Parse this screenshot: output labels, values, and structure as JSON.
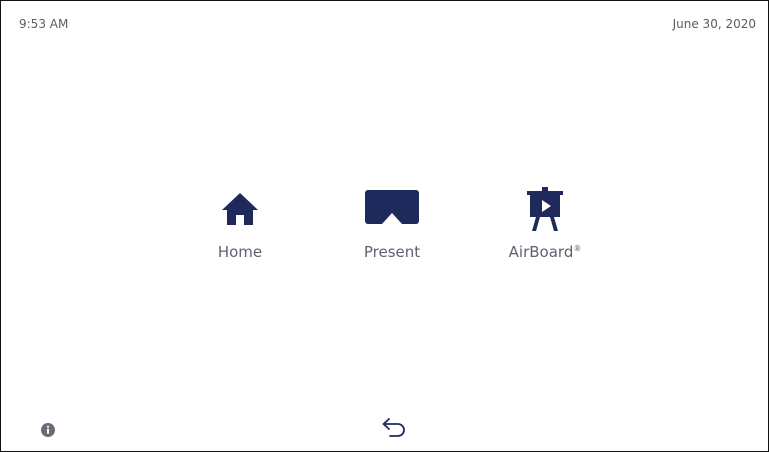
{
  "status_bar": {
    "time": "9:53 AM",
    "date": "June 30, 2020"
  },
  "tiles": [
    {
      "label": "Home",
      "icon": "home-icon"
    },
    {
      "label": "Present",
      "icon": "present-screen-icon"
    },
    {
      "label": "AirBoard",
      "trademark": "®",
      "icon": "airboard-easel-icon"
    }
  ],
  "bottom_bar": {
    "info_icon": "info-icon",
    "back_icon": "back-arrow-icon"
  },
  "colors": {
    "icon_navy": "#1f2a5c",
    "label_gray": "#606070",
    "status_gray": "#5b5b66",
    "info_gray": "#6b6b78"
  }
}
